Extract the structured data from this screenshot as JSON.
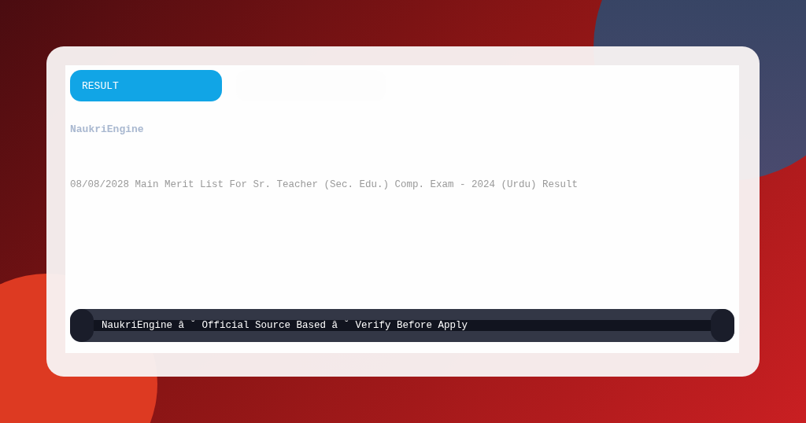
{
  "badge": {
    "label": "RESULT"
  },
  "brand": "NaukriEngine",
  "headline": "08/08/2028 Main Merit List For Sr. Teacher (Sec. Edu.) Comp. Exam - 2024 (Urdu) Result",
  "footer": "NaukriEngine â ˘ Official Source Based â ˘ Verify Before Apply"
}
